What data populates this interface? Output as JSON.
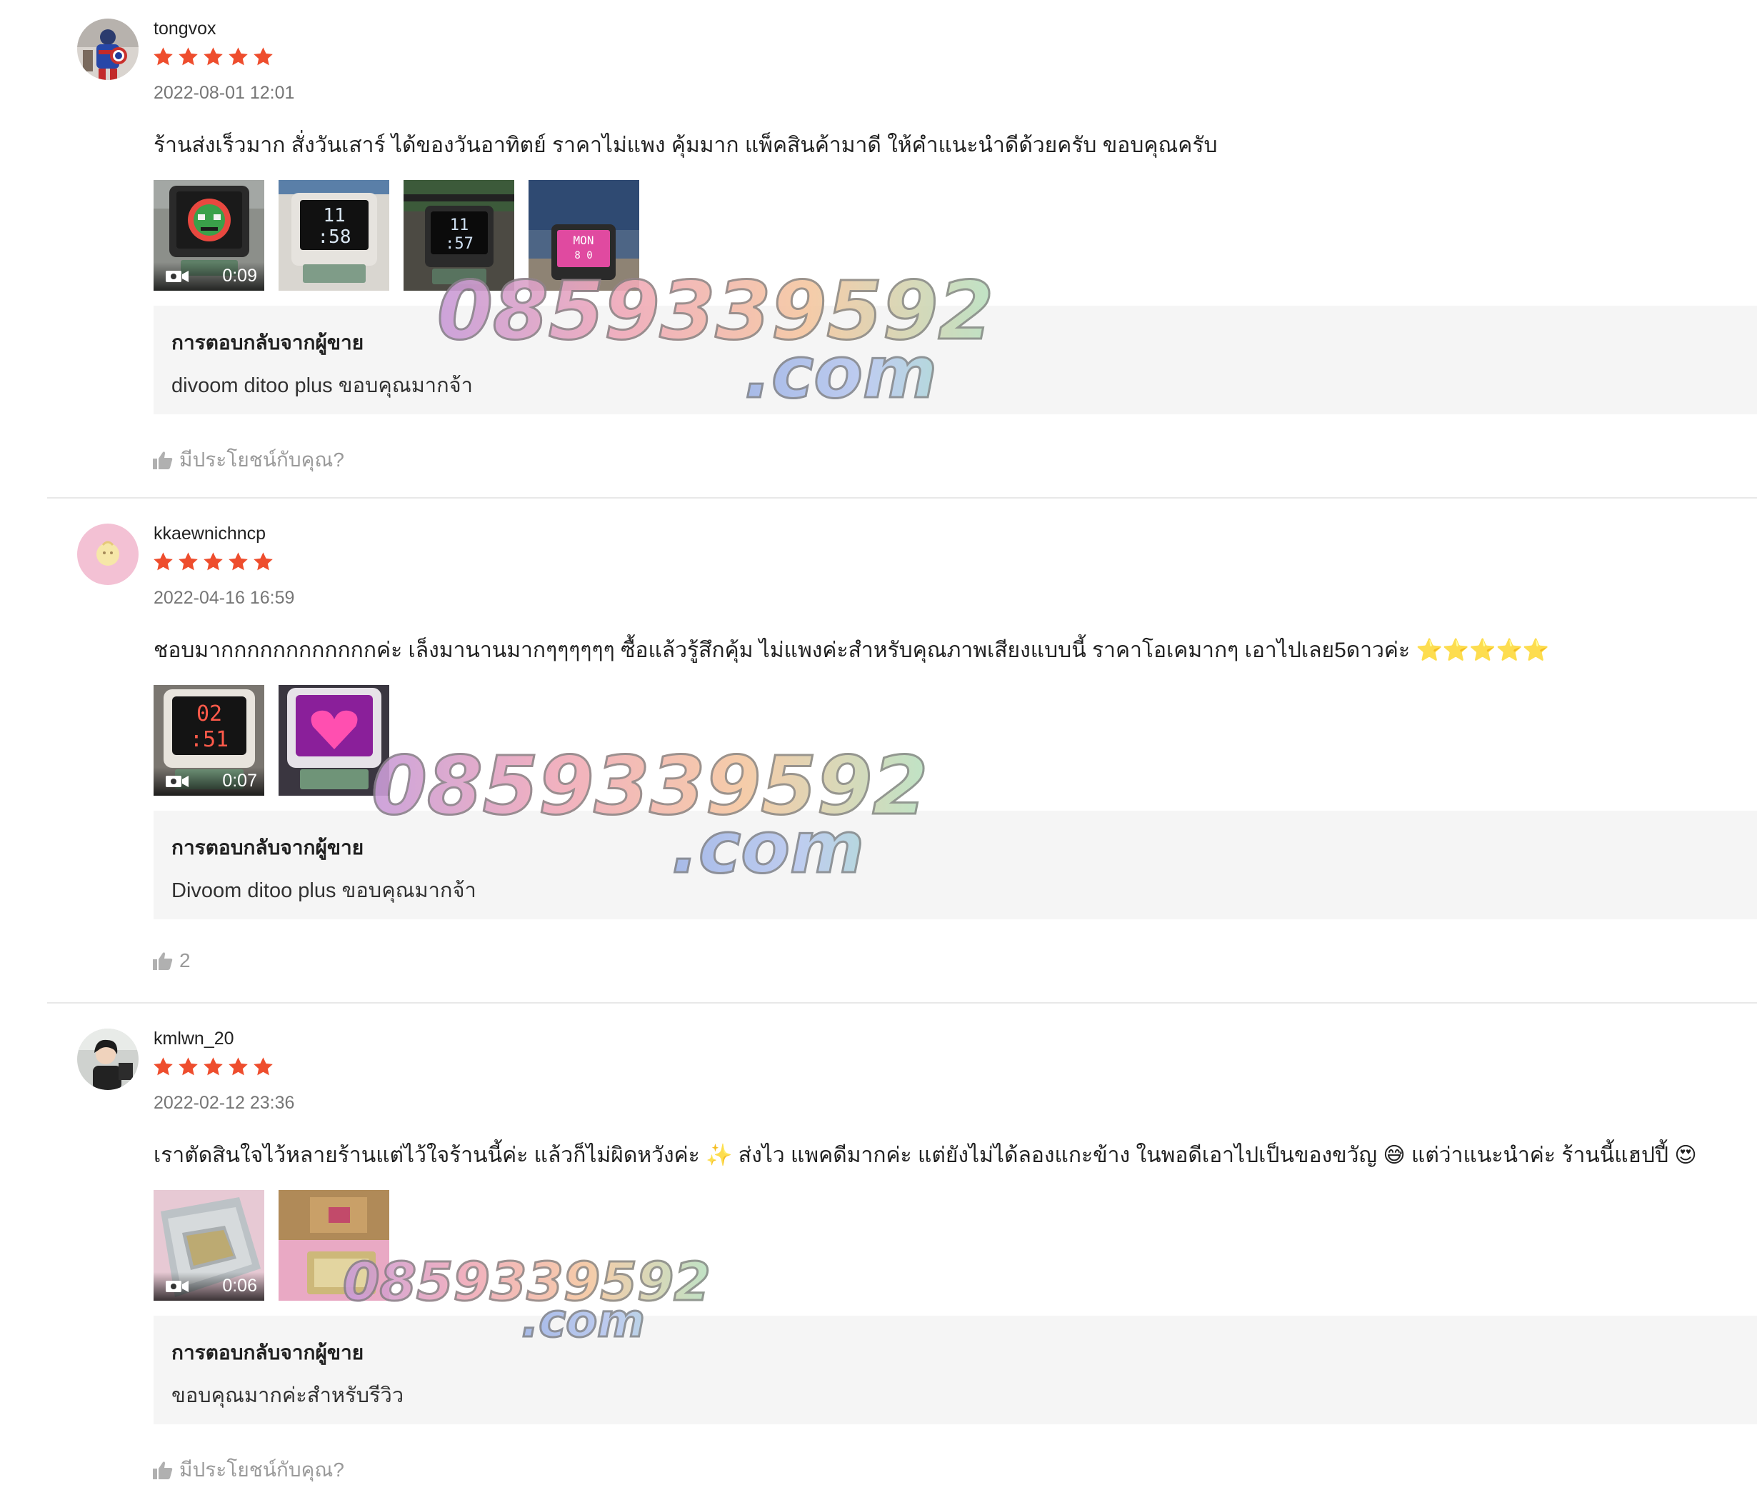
{
  "reviews": [
    {
      "username": "tongvox",
      "avatar_icon": "avatar-superhero-icon",
      "rating": 5,
      "date": "2022-08-01 12:01",
      "comment": "ร้านส่งเร็วมาก สั่งวันเสาร์ ได้ของวันอาทิตย์ ราคาไม่แพง คุ้มมาก แพ็คสินค้ามาดี ให้คำแนะนำดีด้วยครับ ขอบคุณครับ",
      "media": [
        {
          "type": "video",
          "duration": "0:09"
        },
        {
          "type": "image"
        },
        {
          "type": "image"
        },
        {
          "type": "image"
        }
      ],
      "seller_reply_title": "การตอบกลับจากผู้ขาย",
      "seller_reply_text": "divoom ditoo plus ขอบคุณมากจ้า",
      "helpful_label": "มีประโยชน์กับคุณ?"
    },
    {
      "username": "kkaewnichncp",
      "avatar_icon": "avatar-pink-icon",
      "rating": 5,
      "date": "2022-04-16 16:59",
      "comment": "ชอบมากกกกกกกกกกกกค่ะ เล็งมานานมากๆๆๆๆๆๆ ซื้อแล้วรู้สึกคุ้ม ไม่แพงค่ะสำหรับคุณภาพเสียงแบบนี้ ราคาโอเคมากๆ เอาไปเลย5ดาวค่ะ ⭐⭐⭐⭐⭐",
      "media": [
        {
          "type": "video",
          "duration": "0:07"
        },
        {
          "type": "image"
        }
      ],
      "seller_reply_title": "การตอบกลับจากผู้ขาย",
      "seller_reply_text": "Divoom ditoo plus ขอบคุณมากจ้า",
      "helpful_label": "2"
    },
    {
      "username": "kmlwn_20",
      "avatar_icon": "avatar-person-icon",
      "rating": 5,
      "date": "2022-02-12 23:36",
      "comment": "เราตัดสินใจไว้หลายร้านแต่ไว้ใจร้านนี้ค่ะ แล้วก็ไม่ผิดหวังค่ะ ✨ ส่งไว แพคดีมากค่ะ แต่ยังไม่ได้ลองแกะข้าง ในพอดีเอาไปเป็นของขวัญ 😅 แต่ว่าแนะนำค่ะ ร้านนี้แฮปปี้ 😍",
      "media": [
        {
          "type": "video",
          "duration": "0:06"
        },
        {
          "type": "image"
        }
      ],
      "seller_reply_title": "การตอบกลับจากผู้ขาย",
      "seller_reply_text": "ขอบคุณมากค่ะสำหรับรีวิว",
      "helpful_label": "มีประโยชน์กับคุณ?"
    }
  ],
  "watermark": {
    "phone": "0859339592",
    "domain": ".com"
  },
  "colors": {
    "star": "#ee4d2d",
    "reply_bg": "#f5f5f5",
    "muted_text": "rgba(0,0,0,0.54)"
  },
  "thumb_screens": {
    "r1_t1": "",
    "r1_t2": "11\n58",
    "r1_t3": "11\n57",
    "r1_t4": "MON",
    "r2_t1": "02\n51",
    "r2_t2": ""
  }
}
